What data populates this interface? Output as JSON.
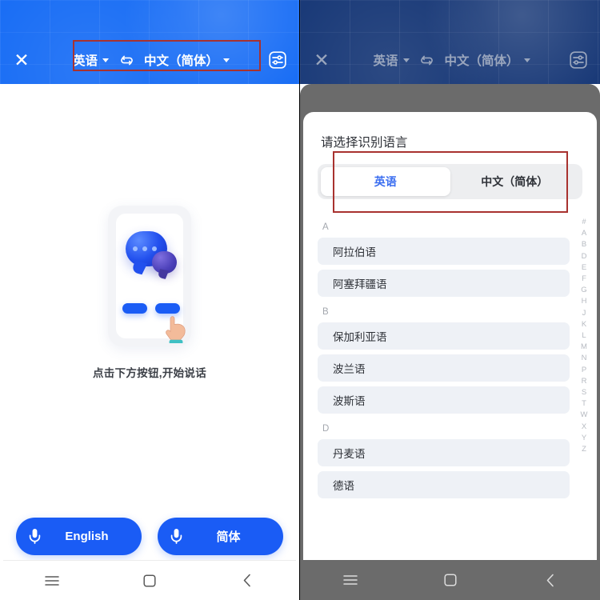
{
  "header": {
    "close_label": "✕",
    "source_lang": "英语",
    "target_lang": "中文（简体）",
    "swap_icon": "swap-icon",
    "settings_icon": "settings-sliders-icon"
  },
  "left": {
    "hint": "点击下方按钮,开始说话",
    "mic_left_label": "English",
    "mic_right_label": "简体",
    "mic_icon": "microphone-icon",
    "illustration": "phone-chat-bubbles-tap-hand-illustration"
  },
  "right": {
    "sheet_title": "请选择识别语言",
    "segments": [
      {
        "label": "英语",
        "active": true
      },
      {
        "label": "中文（简体）",
        "active": false
      }
    ],
    "groups": [
      {
        "letter": "A",
        "items": [
          "阿拉伯语",
          "阿塞拜疆语"
        ]
      },
      {
        "letter": "B",
        "items": [
          "保加利亚语",
          "波兰语",
          "波斯语"
        ]
      },
      {
        "letter": "D",
        "items": [
          "丹麦语",
          "德语"
        ]
      }
    ],
    "alpha_index": [
      "#",
      "A",
      "B",
      "D",
      "E",
      "F",
      "G",
      "H",
      "J",
      "K",
      "L",
      "M",
      "N",
      "P",
      "R",
      "S",
      "T",
      "W",
      "X",
      "Y",
      "Z"
    ]
  },
  "navbar": {
    "menu_icon": "menu-icon",
    "home_icon": "home-square-icon",
    "back_icon": "back-chevron-icon"
  },
  "colors": {
    "brand_blue": "#1a6ef5",
    "button_blue": "#1a5cf5",
    "annotation_red": "#a8322f",
    "dim_header": "#1a3a78",
    "scrim_grey": "#6b6b6b",
    "pill_grey": "#eef1f6"
  }
}
